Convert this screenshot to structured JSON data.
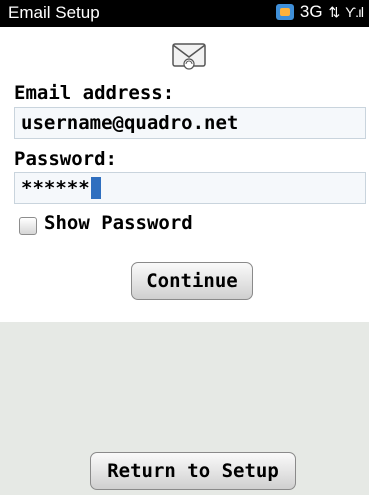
{
  "status_bar": {
    "title": "Email Setup",
    "network": "3G",
    "icons": [
      "bbm-icon",
      "network-3g-icon",
      "data-arrows-icon",
      "signal-strength-icon"
    ]
  },
  "form": {
    "icon": "envelope-icon",
    "email_label": "Email address:",
    "email_value": "username@quadro.net",
    "password_label": "Password:",
    "password_value": "******",
    "show_password_label": "Show Password",
    "show_password_checked": false
  },
  "buttons": {
    "continue_label": "Continue",
    "return_label": "Return to Setup"
  },
  "colors": {
    "status_bar_bg": "#000000",
    "lower_area_bg": "#e6e9e5",
    "cursor": "#2f6fbf"
  }
}
